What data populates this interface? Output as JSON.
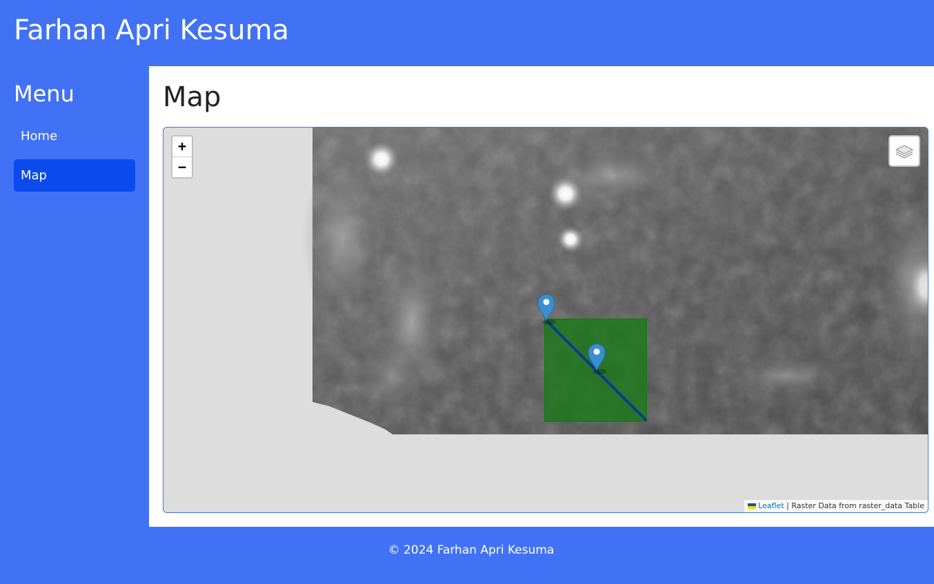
{
  "header": {
    "title": "Farhan Apri Kesuma"
  },
  "sidebar": {
    "title": "Menu",
    "items": [
      {
        "label": "Home",
        "active": false
      },
      {
        "label": "Map",
        "active": true
      }
    ]
  },
  "main": {
    "title": "Map"
  },
  "map": {
    "zoom_in": "+",
    "zoom_out": "−",
    "layers_icon": "layers-icon",
    "attribution": {
      "link": "Leaflet",
      "separator": " | ",
      "text": "Raster Data from raster_data Table"
    },
    "colors": {
      "polygon_fill": "#1a7a1a",
      "polyline": "#0b3d91",
      "marker": "#3a8fd0"
    }
  },
  "footer": {
    "text": "© 2024 Farhan Apri Kesuma"
  },
  "colors": {
    "brand": "#4172f5",
    "active_nav": "#0b4bee"
  }
}
